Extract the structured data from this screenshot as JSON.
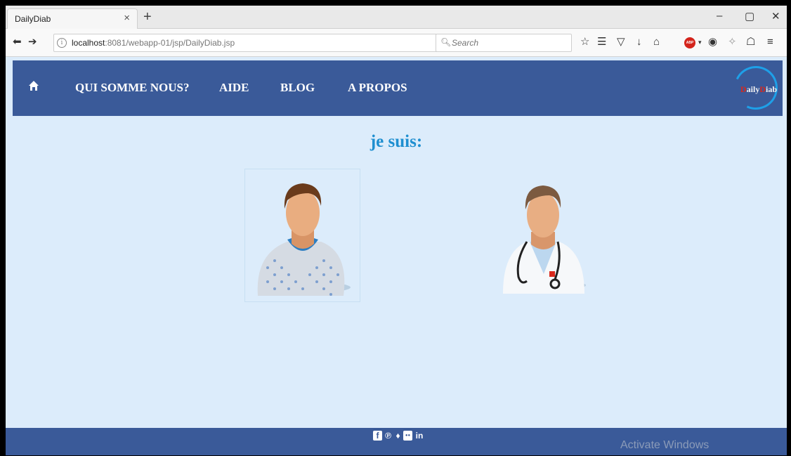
{
  "browser": {
    "tab_title": "DailyDiab",
    "tab_close": "×",
    "new_tab": "+",
    "window_controls": {
      "minimize": "–",
      "maximize": "▢",
      "close": "✕"
    },
    "url_host": "localhost",
    "url_path": ":8081/webapp-01/jsp/DailyDiab.jsp",
    "search_placeholder": "Search",
    "toolbar_icons": [
      "bookmark-star-icon",
      "reading-list-icon",
      "pocket-icon",
      "download-icon",
      "home-icon",
      "adblock-plus-icon",
      "extension-icon",
      "sync-icon",
      "shopping-bag-icon",
      "menu-icon"
    ],
    "adblock_label": "ABP"
  },
  "site": {
    "nav": {
      "items": [
        {
          "label": "QUI SOMME NOUS?"
        },
        {
          "label": "AIDE"
        },
        {
          "label": "BLOG"
        },
        {
          "label": "A PROPOS"
        }
      ]
    },
    "logo": {
      "part1": "D",
      "part2": "aily",
      "part3": "D",
      "part4": "iab"
    },
    "heading": "je suis:",
    "choices": [
      {
        "icon": "patient-icon"
      },
      {
        "icon": "doctor-icon"
      }
    ],
    "footer": {
      "social_icons": [
        "facebook-icon",
        "pinterest-icon",
        "twitter-icon",
        "flickr-icon",
        "linkedin-icon"
      ],
      "social_glyphs": {
        "facebook": "f",
        "pinterest": "℗",
        "twitter": "♦",
        "flickr": "●●",
        "linkedin": "in"
      }
    },
    "watermark": "Activate Windows"
  },
  "colors": {
    "header_bg": "#3a5a99",
    "page_bg": "#dcecfb",
    "heading": "#1f8fd0",
    "logo_ring": "#1ea0e8",
    "logo_accent": "#d8281c"
  }
}
